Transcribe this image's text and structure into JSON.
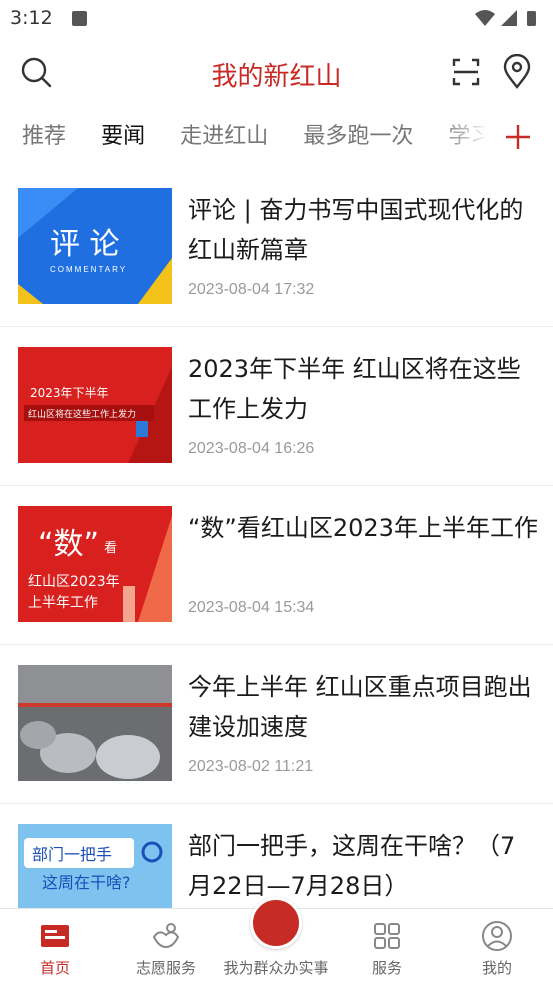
{
  "status_bar": {
    "time": "3:12"
  },
  "header": {
    "title": "我的新红山"
  },
  "tabs": [
    {
      "label": "推荐"
    },
    {
      "label": "要闻"
    },
    {
      "label": "走进红山"
    },
    {
      "label": "最多跑一次"
    },
    {
      "label": "学习"
    }
  ],
  "news": [
    {
      "title": "评论 | 奋力书写中国式现代化的红山新篇章",
      "date": "2023-08-04 17:32",
      "thumb_big": "评 论",
      "thumb_small": "COMMENTARY"
    },
    {
      "title": "2023年下半年 红山区将在这些工作上发力",
      "date": "2023-08-04 16:26",
      "thumb_line1": "2023年下半年",
      "thumb_line2": "红山区将在这些工作上发力"
    },
    {
      "title": "“数”看红山区2023年上半年工作",
      "date": "2023-08-04 15:34",
      "thumb_big": "“数”",
      "thumb_small": "看",
      "thumb_line1": "红山区2023年",
      "thumb_line2": "上半年工作"
    },
    {
      "title": "今年上半年 红山区重点项目跑出建设加速度",
      "date": "2023-08-02 11:21"
    },
    {
      "title": "部门一把手，这周在干啥？（7月22日—7月28日）",
      "date": "",
      "thumb_line1": "部门一把手",
      "thumb_line2": "这周在干啥?"
    }
  ],
  "bottom_nav": [
    {
      "label": "首页",
      "icon": "news-icon",
      "active": true
    },
    {
      "label": "志愿服务",
      "icon": "volunteer-icon",
      "active": false
    },
    {
      "label": "我为群众办实事",
      "icon": "service-badge-icon",
      "active": false
    },
    {
      "label": "服务",
      "icon": "grid-icon",
      "active": false
    },
    {
      "label": "我的",
      "icon": "user-icon",
      "active": false
    }
  ],
  "colors": {
    "accent": "#c62b25",
    "blue": "#1e6fd9",
    "text": "#1b1b1b",
    "muted": "#9a9a9a"
  }
}
